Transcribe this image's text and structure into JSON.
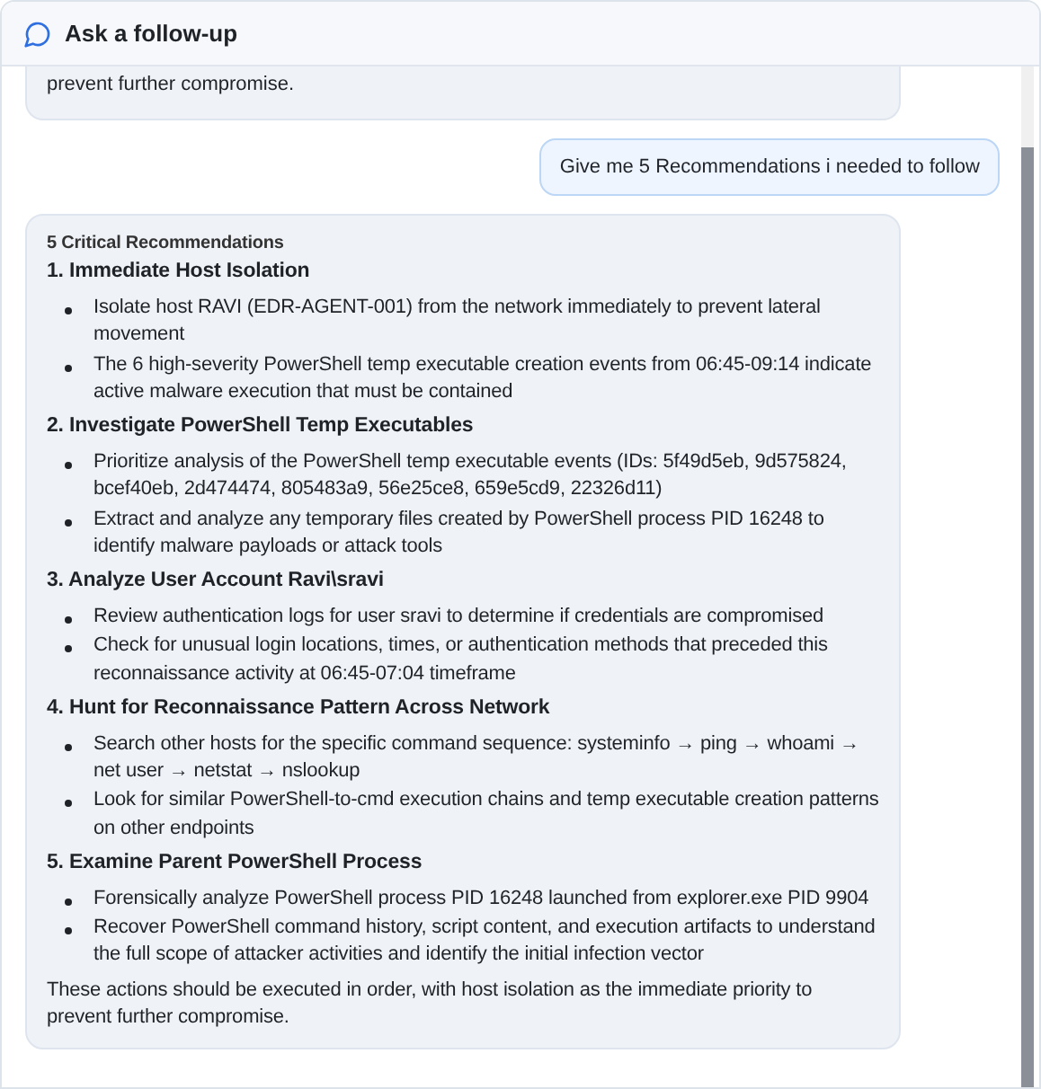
{
  "header": {
    "title": "Ask a follow-up"
  },
  "messages": [
    {
      "kind": "assistant-tail",
      "text": "prevent further compromise."
    },
    {
      "kind": "user",
      "text": "Give me 5 Recommendations i needed to follow"
    },
    {
      "kind": "assistant",
      "blocks": [
        {
          "kind": "caption",
          "text": "5 Critical Recommendations"
        },
        {
          "kind": "heading",
          "text": "1. Immediate Host Isolation"
        },
        {
          "kind": "bullets",
          "items": [
            "Isolate host RAVI (EDR-AGENT-001) from the network immediately to prevent lateral movement",
            "The 6 high-severity PowerShell temp executable creation events from 06:45-09:14 indicate active malware execution that must be contained"
          ]
        },
        {
          "kind": "heading",
          "text": "2. Investigate PowerShell Temp Executables"
        },
        {
          "kind": "bullets",
          "items": [
            "Prioritize analysis of the PowerShell temp executable events (IDs: 5f49d5eb, 9d575824, bcef40eb, 2d474474, 805483a9, 56e25ce8, 659e5cd9, 22326d11)",
            "Extract and analyze any temporary files created by PowerShell process PID 16248 to identify malware payloads or attack tools"
          ]
        },
        {
          "kind": "heading",
          "text": "3. Analyze User Account Ravi\\sravi"
        },
        {
          "kind": "bullets",
          "items": [
            "Review authentication logs for user sravi to determine if credentials are compromised",
            "Check for unusual login locations, times, or authentication methods that preceded this reconnaissance activity at 06:45-07:04 timeframe"
          ]
        },
        {
          "kind": "heading",
          "text": "4. Hunt for Reconnaissance Pattern Across Network"
        },
        {
          "kind": "bullets",
          "items": [
            "Search other hosts for the specific command sequence: systeminfo → ping → whoami → net user → netstat → nslookup",
            "Look for similar PowerShell-to-cmd execution chains and temp executable creation patterns on other endpoints"
          ]
        },
        {
          "kind": "heading",
          "text": "5. Examine Parent PowerShell Process"
        },
        {
          "kind": "bullets",
          "items": [
            "Forensically analyze PowerShell process PID 16248 launched from explorer.exe PID 9904",
            "Recover PowerShell command history, script content, and execution artifacts to understand the full scope of attacker activities and identify the initial infection vector"
          ]
        },
        {
          "kind": "paragraph",
          "text": "These actions should be executed in order, with host isolation as the immediate priority to prevent further compromise."
        }
      ]
    }
  ]
}
